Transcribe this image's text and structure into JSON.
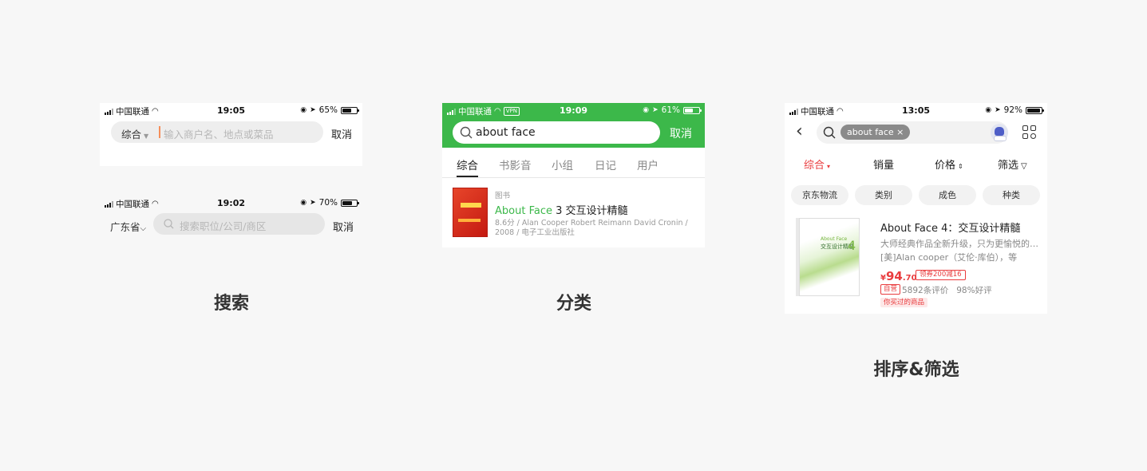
{
  "sections": [
    {
      "title": "搜索"
    },
    {
      "title": "分类"
    },
    {
      "title": "排序&筛选"
    }
  ],
  "panel1": {
    "status": {
      "carrier": "中国联通",
      "time": "19:05",
      "battery": "65%",
      "battery_level": 0.65
    },
    "category": "综合",
    "placeholder": "输入商户名、地点或菜品",
    "cancel": "取消"
  },
  "panel2": {
    "status": {
      "carrier": "中国联通",
      "time": "19:02",
      "battery": "70%",
      "battery_level": 0.7
    },
    "province": "广东省",
    "placeholder": "搜索职位/公司/商区",
    "cancel": "取消"
  },
  "panel3": {
    "status": {
      "carrier": "中国联通",
      "vpn": "VPN",
      "time": "19:09",
      "battery": "61%",
      "battery_level": 0.61
    },
    "query": "about face",
    "cancel": "取消",
    "tabs": [
      "综合",
      "书影音",
      "小组",
      "日记",
      "用户"
    ],
    "result": {
      "type": "图书",
      "title_hl": "About Face",
      "title_rest": " 3 交互设计精髓",
      "meta_line1": "8.6分 / Alan Cooper Robert Reimann David Cronin /",
      "meta_line2": "2008 / 电子工业出版社"
    },
    "accent": "#3cb84a"
  },
  "panel4": {
    "status": {
      "carrier": "中国联通",
      "time": "13:05",
      "battery": "92%",
      "battery_level": 0.92
    },
    "query_tag": "about face",
    "query_tag_close": "×",
    "sorts": [
      {
        "label": "综合",
        "arrow": "▾"
      },
      {
        "label": "销量",
        "arrow": ""
      },
      {
        "label": "价格",
        "arrow": "⇕"
      },
      {
        "label": "筛选",
        "arrow": "▽"
      }
    ],
    "chips": [
      "京东物流",
      "类别",
      "成色",
      "种类"
    ],
    "product": {
      "cover_title": "交互设计精髓",
      "cover_subtitle": "About Face",
      "cover_num": "4",
      "title": "About Face 4：交互设计精髓",
      "desc": "大师经典作品全新升级，只为更愉悦的…",
      "author": "[美]Alan cooper（艾伦·库伯），等",
      "price_currency": "¥",
      "price_int": "94",
      "price_dec": ".70",
      "coupon": "领券200减16",
      "self_tag": "自营",
      "reviews": "5892条评价",
      "positive": "98%好评",
      "seen_tag": "你买过的商品"
    },
    "accent": "#e93b3d"
  }
}
